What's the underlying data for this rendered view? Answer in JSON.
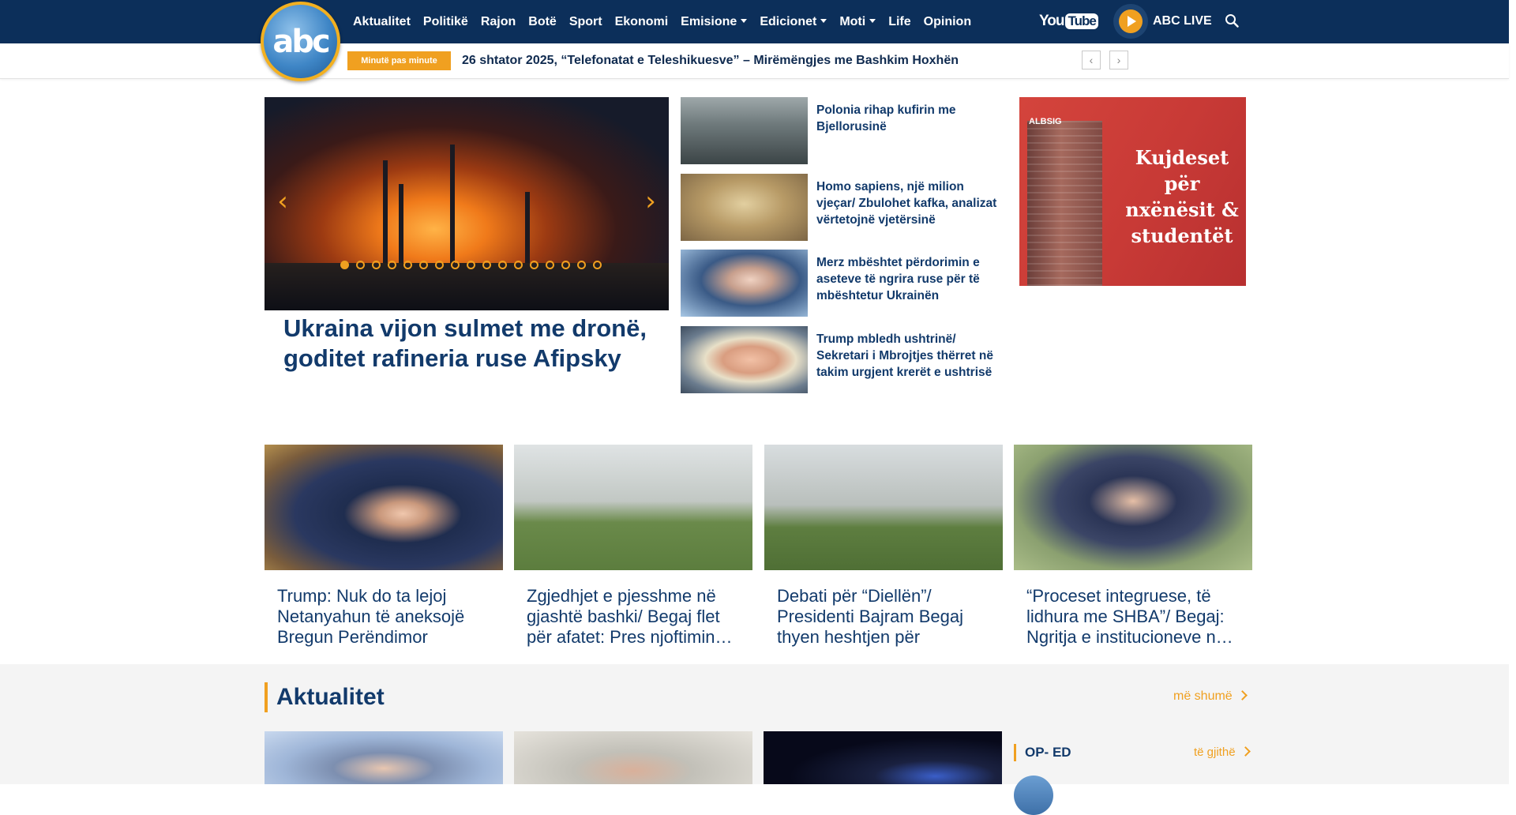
{
  "brand": {
    "logo_text": "abc"
  },
  "nav": {
    "items": [
      {
        "label": "Aktualitet",
        "dropdown": false
      },
      {
        "label": "Politikë",
        "dropdown": false
      },
      {
        "label": "Rajon",
        "dropdown": false
      },
      {
        "label": "Botë",
        "dropdown": false
      },
      {
        "label": "Sport",
        "dropdown": false
      },
      {
        "label": "Ekonomi",
        "dropdown": false
      },
      {
        "label": "Emisione",
        "dropdown": true
      },
      {
        "label": "Edicionet",
        "dropdown": true
      },
      {
        "label": "Moti",
        "dropdown": true
      },
      {
        "label": "Life",
        "dropdown": false
      },
      {
        "label": "Opinion",
        "dropdown": false
      }
    ],
    "youtube_you": "You",
    "youtube_tube": "Tube",
    "live_label": "ABC LIVE",
    "search_icon": "search-icon"
  },
  "ticker": {
    "badge": "Minutë pas minute",
    "headline": "26 shtator 2025, “Telefonatat e Teleshikuesve” – Mirëmëngjes me Bashkim Hoxhën",
    "prev_label": "‹",
    "next_label": "›"
  },
  "hero": {
    "title": "Ukraina vijon sulmet me dronë, goditet rafineria ruse Afipsky",
    "prev_arrow": "‹",
    "next_arrow": "›",
    "slide_count": 17,
    "active_slide": 1
  },
  "side_list": [
    {
      "title": "Polonia rihap kufirin me Bjellorusinë"
    },
    {
      "title": "Homo sapiens, një milion vjeçar/ Zbulohet kafka, analizat vërtetojnë vjetërsinë"
    },
    {
      "title": "Merz mbështet përdorimin e aseteve të ngrira ruse për të mbështetur Ukrainën"
    },
    {
      "title": "Trump mbledh ushtrinë/ Sekretari i Mbrojtjes thërret në takim urgjent krerët e ushtrisë"
    }
  ],
  "ad": {
    "brand": "ALBSIG",
    "slogan": "Kujdeset për nxënësit & studentët",
    "accent": "#c83a36"
  },
  "cards": [
    {
      "title": "Trump: Nuk do ta lejoj Netanyahun të aneksojë Bregun Perëndimor"
    },
    {
      "title": "Zgjedhjet e pjesshme në gjashtë bashki/ Begaj flet për afatet: Pres njoftimin…"
    },
    {
      "title": "Debati për “Diellën”/ Presidenti Bajram Begaj thyen heshtjen për dekret…"
    },
    {
      "title": "“Proceset integruese, të lidhura me SHBA”/ Begaj: Ngritja e institucioneve n…"
    }
  ],
  "section": {
    "title": "Aktualitet",
    "more_label": "më shumë",
    "oped_title": "OP- ED",
    "oped_link": "të gjithë"
  },
  "colors": {
    "navy": "#0c2f5a",
    "accent": "#f0a020",
    "headline": "#123a6b"
  }
}
